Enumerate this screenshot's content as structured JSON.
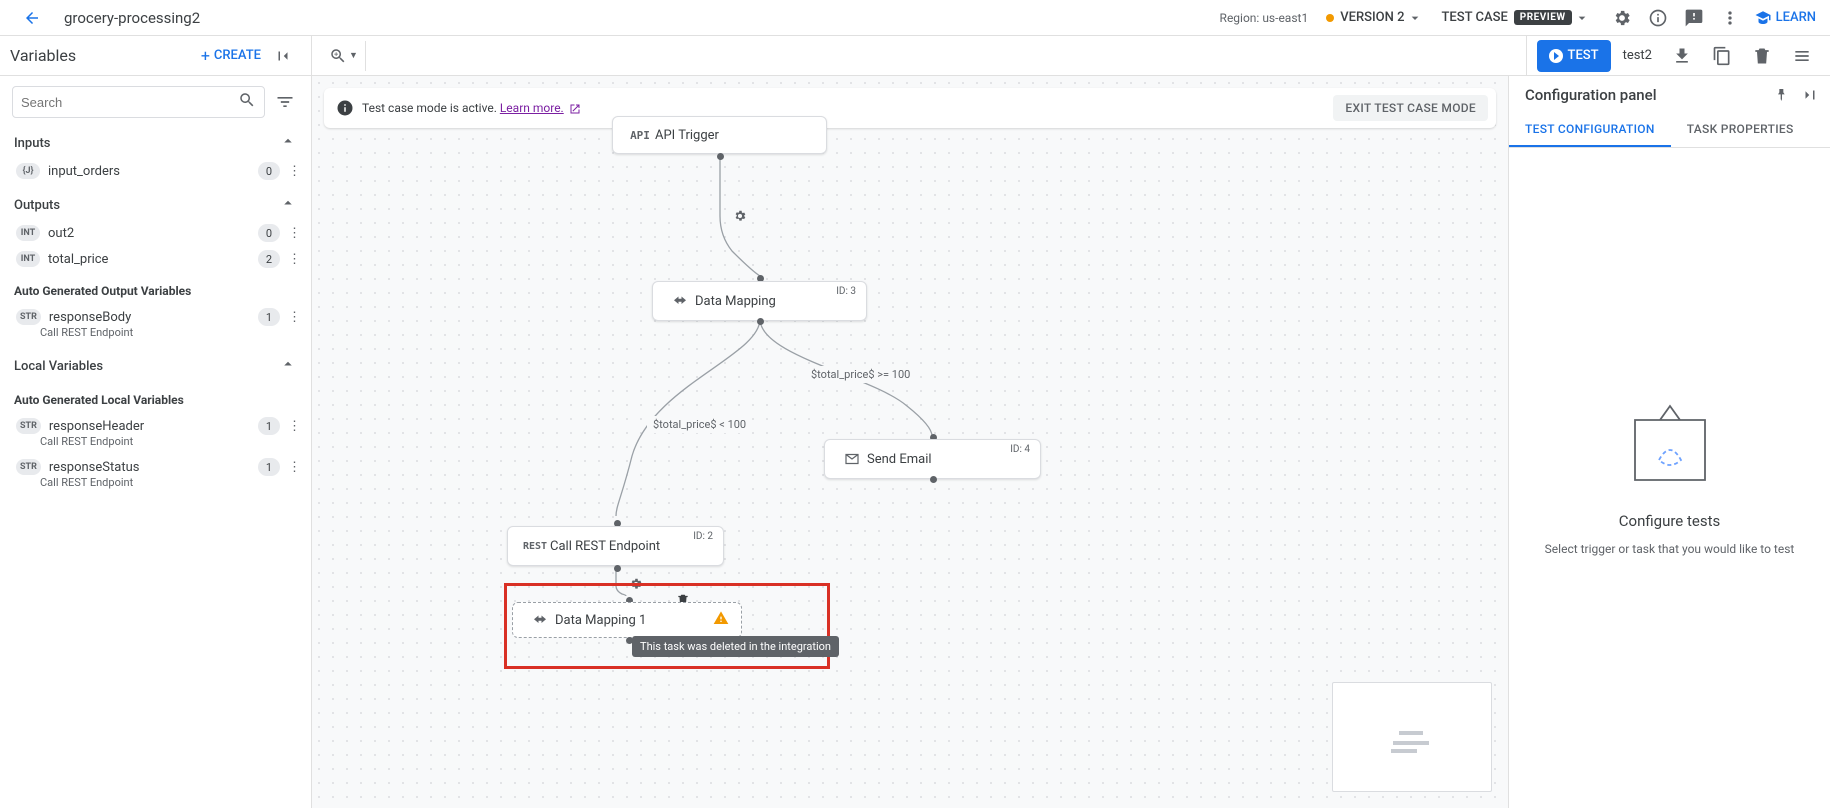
{
  "topbar": {
    "title": "grocery-processing2",
    "region": "Region: us-east1",
    "version_label": "VERSION 2",
    "testcase_label": "TEST CASE",
    "preview_pill": "PREVIEW",
    "learn": "LEARN"
  },
  "secondbar": {
    "variables_heading": "Variables",
    "create_label": "CREATE",
    "test_btn": "TEST",
    "test_name": "test2"
  },
  "variables": {
    "search_placeholder": "Search",
    "inputs_label": "Inputs",
    "inputs": [
      {
        "type": "{J}",
        "name": "input_orders",
        "count": "0"
      }
    ],
    "outputs_label": "Outputs",
    "outputs": [
      {
        "type": "INT",
        "name": "out2",
        "count": "0"
      },
      {
        "type": "INT",
        "name": "total_price",
        "count": "2"
      }
    ],
    "auto_out_label": "Auto Generated Output Variables",
    "auto_out": [
      {
        "type": "STR",
        "name": "responseBody",
        "sub": "Call REST Endpoint",
        "count": "1"
      }
    ],
    "local_label": "Local Variables",
    "auto_local_label": "Auto Generated Local Variables",
    "auto_local": [
      {
        "type": "STR",
        "name": "responseHeader",
        "sub": "Call REST Endpoint",
        "count": "1"
      },
      {
        "type": "STR",
        "name": "responseStatus",
        "sub": "Call REST Endpoint",
        "count": "1"
      }
    ]
  },
  "canvas": {
    "banner_msg": "Test case mode is active. ",
    "banner_link": "Learn more.",
    "banner_exit": "EXIT TEST CASE MODE",
    "nodes": {
      "api": {
        "label": "API Trigger",
        "icon_text": "API"
      },
      "dmap": {
        "label": "Data Mapping",
        "id": "ID: 3"
      },
      "email": {
        "label": "Send Email",
        "id": "ID: 4"
      },
      "rest": {
        "label": "Call REST Endpoint",
        "icon_text": "REST",
        "id": "ID: 2"
      },
      "dmap1": {
        "label": "Data Mapping 1"
      }
    },
    "cond_lt": "$total_price$ < 100",
    "cond_ge": "$total_price$ >= 100",
    "deleted_tooltip": "This task was deleted in the integration"
  },
  "config": {
    "title": "Configuration panel",
    "tab_test": "TEST CONFIGURATION",
    "tab_task": "TASK PROPERTIES",
    "big": "Configure tests",
    "small": "Select trigger or task that you would like to test"
  }
}
